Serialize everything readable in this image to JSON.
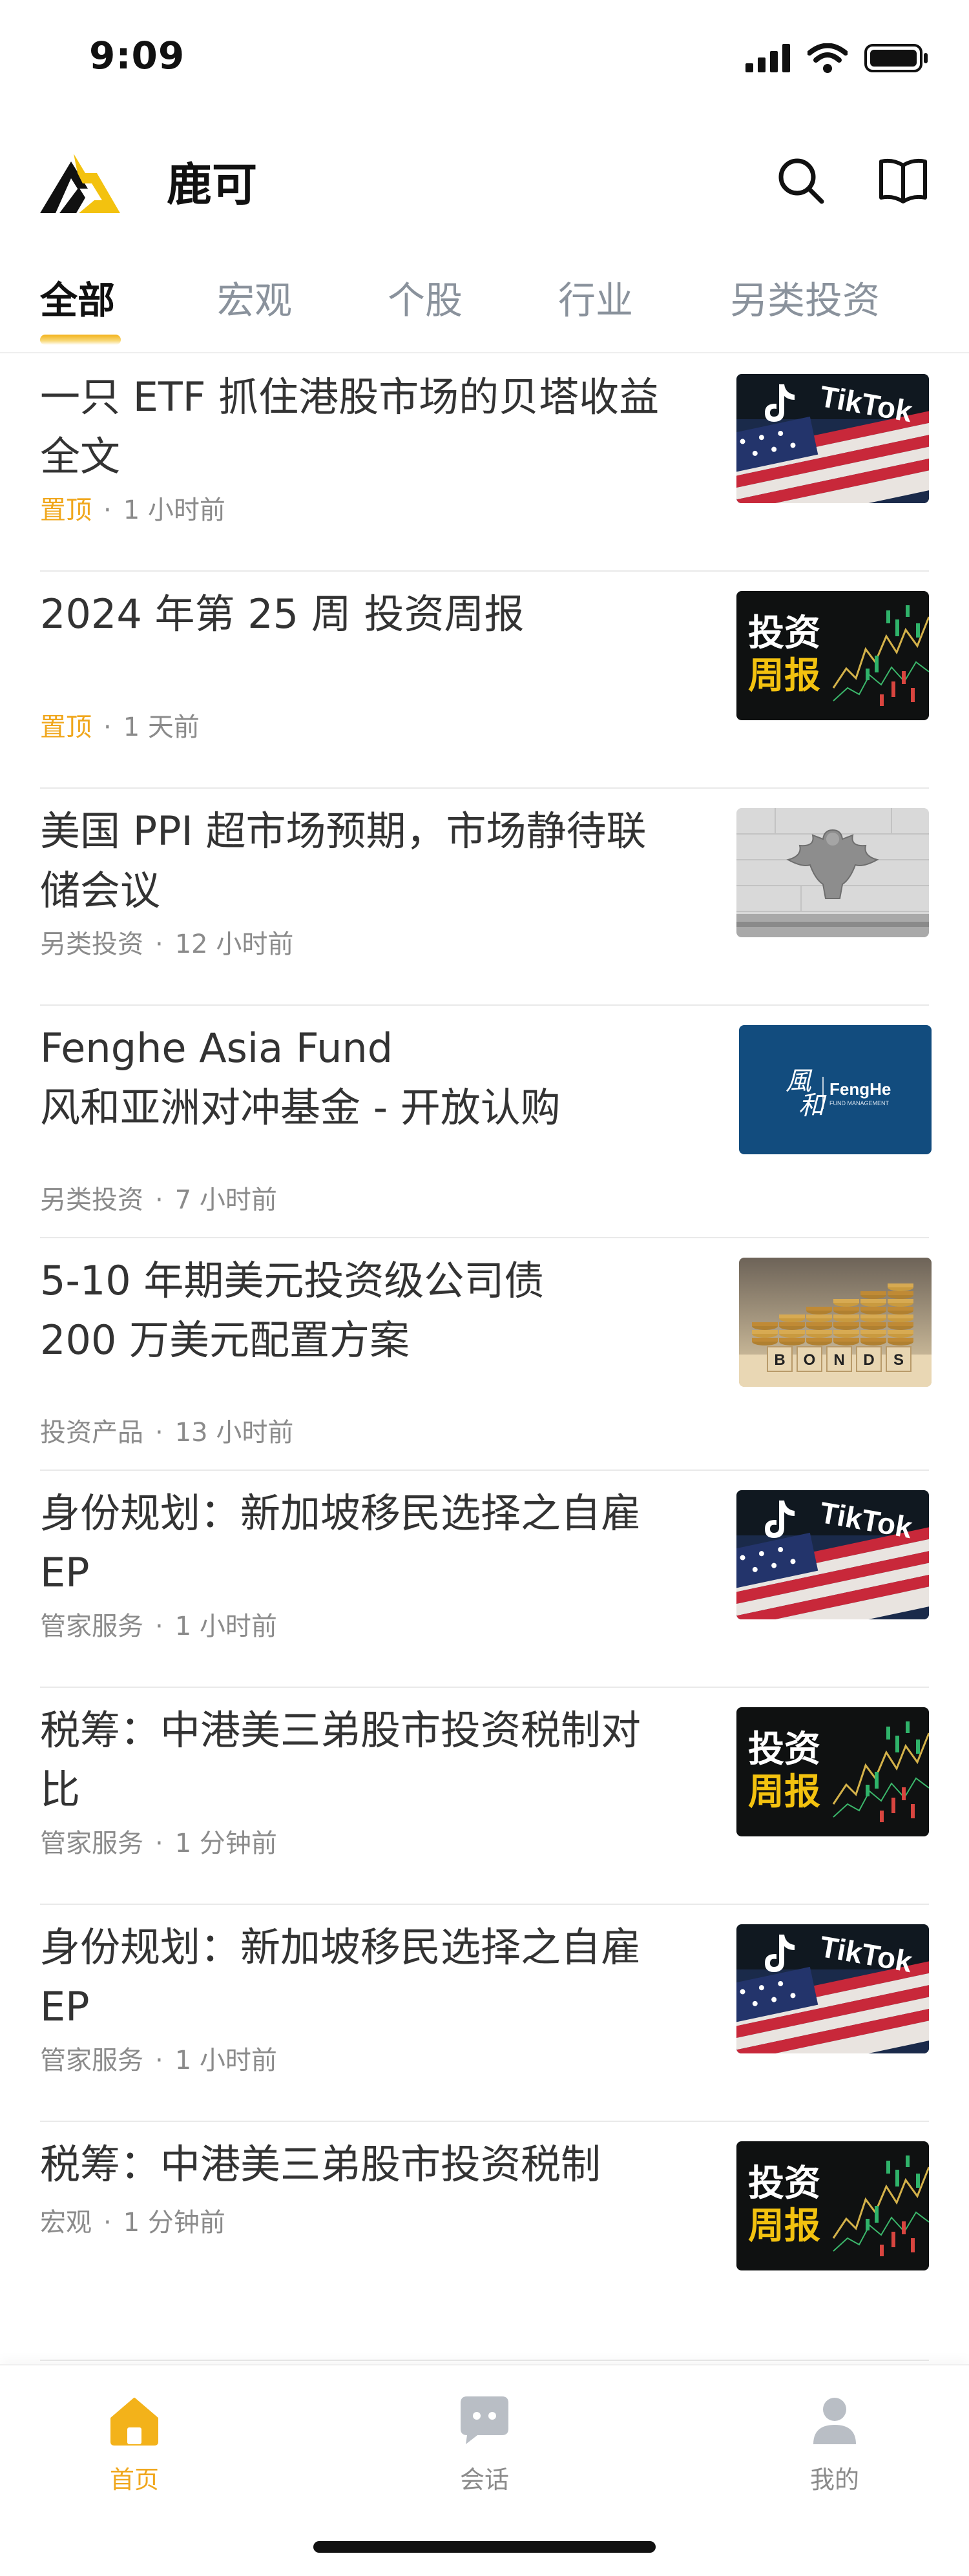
{
  "status": {
    "time": "9:09"
  },
  "app": {
    "title": "鹿可"
  },
  "tabs": [
    "全部",
    "宏观",
    "个股",
    "行业",
    "另类投资"
  ],
  "items": [
    {
      "title": "一只 ETF 抓住港股市场的贝塔收益全文",
      "tag": "置顶",
      "time": "1 小时前",
      "thumb": "tiktok"
    },
    {
      "title": "2024 年第 25 周 投资周报",
      "tag": "置顶",
      "time": "1 天前",
      "thumb": "weekly"
    },
    {
      "title": "美国 PPI 超市场预期，市场静待联储会议",
      "tag": "另类投资",
      "time": "12 小时前",
      "thumb": "eagle"
    },
    {
      "title": "Fenghe Asia Fund\n风和亚洲对冲基金 - 开放认购",
      "tag": "另类投资",
      "time": "7 小时前",
      "thumb": "fenghe"
    },
    {
      "title": "5-10 年期美元投资级公司债\n200 万美元配置方案",
      "tag": "投资产品",
      "time": "13 小时前",
      "thumb": "bonds"
    },
    {
      "title": "身份规划：新加坡移民选择之自雇 EP",
      "tag": "管家服务",
      "time": "1 小时前",
      "thumb": "tiktok"
    },
    {
      "title": "税筹：中港美三弟股市投资税制对比",
      "tag": "管家服务",
      "time": "1 分钟前",
      "thumb": "weekly"
    },
    {
      "title": "身份规划：新加坡移民选择之自雇 EP",
      "tag": "管家服务",
      "time": "1 小时前",
      "thumb": "tiktok"
    },
    {
      "title": "税筹：中港美三弟股市投资税制",
      "tag": "宏观",
      "time": "1 分钟前",
      "thumb": "weekly"
    }
  ],
  "thumb_text": {
    "tiktok": "TikTok",
    "weekly_line1": "投资",
    "weekly_line2": "周报",
    "fenghe_chinese": "風和",
    "fenghe_brand": "FengHe",
    "fenghe_sub": "FUND MANAGEMENT",
    "bonds_letters": [
      "B",
      "O",
      "N",
      "D",
      "S"
    ]
  },
  "bottom_nav": [
    {
      "label": "首页",
      "icon": "home-icon",
      "active": true
    },
    {
      "label": "会话",
      "icon": "chat-icon",
      "active": false
    },
    {
      "label": "我的",
      "icon": "profile-icon",
      "active": false
    }
  ],
  "colors": {
    "accent": "#f0a71d",
    "muted": "#8b8b8b",
    "dark_thumb": "#141414",
    "fenghe_blue": "#124c7e"
  }
}
